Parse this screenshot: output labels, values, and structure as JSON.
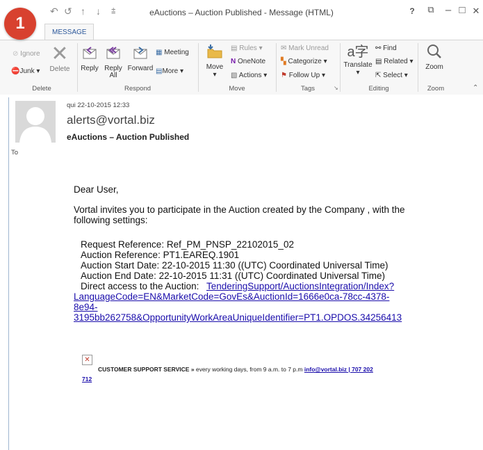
{
  "window": {
    "title": "eAuctions – Auction Published - Message (HTML)",
    "help": "?",
    "restore": "⧉",
    "minimize": "–",
    "maximize": "□",
    "close": "✕"
  },
  "badge": "1",
  "tabs": {
    "message": "MESSAGE"
  },
  "ribbon": {
    "delete": {
      "ignore": "Ignore",
      "junk": "Junk",
      "delete": "Delete",
      "label": "Delete"
    },
    "respond": {
      "reply": "Reply",
      "reply_all_1": "Reply",
      "reply_all_2": "All",
      "forward": "Forward",
      "meeting": "Meeting",
      "more": "More",
      "label": "Respond"
    },
    "move": {
      "move": "Move",
      "rules": "Rules",
      "onenote": "OneNote",
      "actions": "Actions",
      "label": "Move"
    },
    "tags": {
      "mark_unread": "Mark Unread",
      "categorize": "Categorize",
      "follow_up": "Follow Up",
      "label": "Tags"
    },
    "editing": {
      "translate": "Translate",
      "find": "Find",
      "related": "Related",
      "select": "Select",
      "label": "Editing"
    },
    "zoom": {
      "zoom": "Zoom",
      "label": "Zoom"
    }
  },
  "header": {
    "date": "qui 22-10-2015 12:33",
    "from": "alerts@vortal.biz",
    "subject": "eAuctions – Auction Published",
    "to": "To"
  },
  "body": {
    "greeting": "Dear User,",
    "intro_1": "Vortal invites you to participate in the Auction created by the Company , with the",
    "intro_2": "following settings:",
    "req_ref": "Request Reference:  Ref_PM_PNSP_22102015_02",
    "auc_ref": "Auction Reference:  PT1.EAREQ.1901",
    "start": "Auction Start Date:  22-10-2015 11:30 ((UTC) Coordinated Universal Time)",
    "end": "Auction End Date:  22-10-2015 11:31 ((UTC) Coordinated Universal Time)",
    "direct_label": "Direct access to the Auction:",
    "link_1": "TenderingSupport/AuctionsIntegration/Index?",
    "link_2": "LanguageCode=EN&MarketCode=GovEs&AuctionId=1666e0ca-78cc-4378-",
    "link_3": "8e94-",
    "link_4": "3195bb262758&OpportunityWorkAreaUniqueIdentifier=PT1.OPDOS.34256413"
  },
  "footer": {
    "broken_image": "✕",
    "support_bold": "CUSTOMER SUPPORT SERVICE »",
    "support_text": " every working days, from 9 a.m. to 7 p.m ",
    "support_link": "info@vortal.biz | 707 202",
    "support_link_2": "712"
  },
  "colors": {
    "accent": "#2b579a",
    "badge": "#d8412f",
    "link": "#1a0dab"
  }
}
